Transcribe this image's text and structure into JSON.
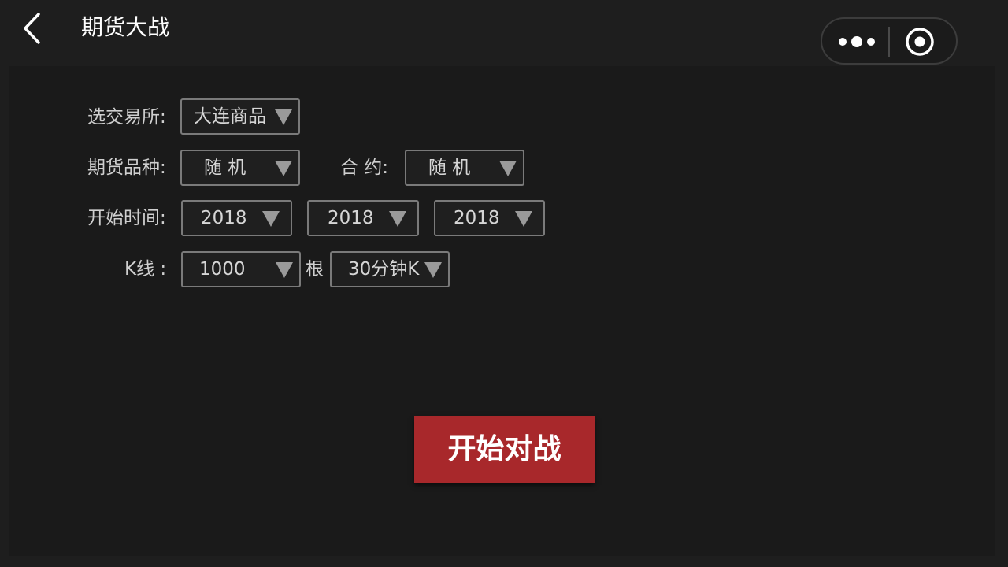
{
  "navbar": {
    "title": "期货大战",
    "back_icon": "chevron-left-icon",
    "more_icon": "more-dots-icon",
    "close_icon": "target-close-icon"
  },
  "form": {
    "exchange": {
      "label": "选交易所:",
      "value": "大连商品"
    },
    "variety": {
      "label": "期货品种:",
      "value": "随 机"
    },
    "contract": {
      "label": "合 约:",
      "value": "随 机"
    },
    "start_time": {
      "label": "开始时间:",
      "year": "2018",
      "month": "2018",
      "day": "2018"
    },
    "kline": {
      "label": "K线 :",
      "count": "1000",
      "unit_label": "根",
      "period": "30分钟K"
    }
  },
  "start_button": {
    "label": "开始对战",
    "color": "#a8282b"
  }
}
